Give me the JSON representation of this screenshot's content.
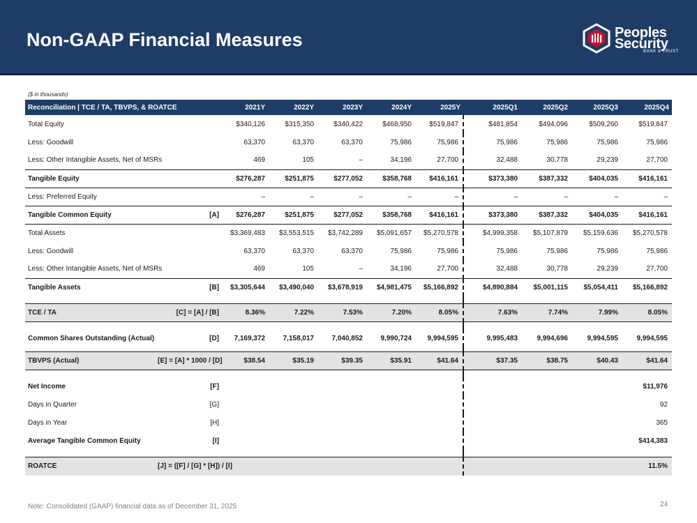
{
  "header": {
    "title": "Non-GAAP Financial Measures"
  },
  "logo": {
    "name_line1": "Peoples",
    "name_line2": "Security",
    "sub": "BANK & TRUST",
    "accent": "#c8102e"
  },
  "units_note": "($ in thousands)",
  "table": {
    "header_label": "Reconciliation | TCE / TA, TBVPS, & ROATCE",
    "columns": [
      "2021Y",
      "2022Y",
      "2023Y",
      "2024Y",
      "2025Y",
      "2025Q1",
      "2025Q2",
      "2025Q3",
      "2025Q4"
    ],
    "rows": [
      {
        "label": "Total Equity",
        "ref": "",
        "values": [
          "$340,126",
          "$315,350",
          "$340,422",
          "$468,950",
          "$519,847",
          "$481,854",
          "$494,096",
          "$509,260",
          "$519,847"
        ]
      },
      {
        "label": "Less: Goodwill",
        "ref": "",
        "values": [
          "63,370",
          "63,370",
          "63,370",
          "75,986",
          "75,986",
          "75,986",
          "75,986",
          "75,986",
          "75,986"
        ]
      },
      {
        "label": "Less: Other Intangible Assets, Net of MSRs",
        "ref": "",
        "values": [
          "469",
          "105",
          "–",
          "34,196",
          "27,700",
          "32,488",
          "30,778",
          "29,239",
          "27,700"
        ]
      },
      {
        "label": "Tangible Equity",
        "ref": "",
        "values": [
          "$276,287",
          "$251,875",
          "$277,052",
          "$358,768",
          "$416,161",
          "$373,380",
          "$387,332",
          "$404,035",
          "$416,161"
        ]
      },
      {
        "label": "Less: Preferred Equity",
        "ref": "",
        "values": [
          "–",
          "–",
          "–",
          "–",
          "–",
          "–",
          "–",
          "–",
          "–"
        ]
      },
      {
        "label": "Tangible Common Equity",
        "ref": "[A]",
        "values": [
          "$276,287",
          "$251,875",
          "$277,052",
          "$358,768",
          "$416,161",
          "$373,380",
          "$387,332",
          "$404,035",
          "$416,161"
        ]
      },
      {
        "label": "Total Assets",
        "ref": "",
        "values": [
          "$3,369,483",
          "$3,553,515",
          "$3,742,289",
          "$5,091,657",
          "$5,270,578",
          "$4,999,358",
          "$5,107,879",
          "$5,159,636",
          "$5,270,578"
        ]
      },
      {
        "label": "Less: Goodwill",
        "ref": "",
        "values": [
          "63,370",
          "63,370",
          "63,370",
          "75,986",
          "75,986",
          "75,986",
          "75,986",
          "75,986",
          "75,986"
        ]
      },
      {
        "label": "Less: Other Intangible Assets, Net of MSRs",
        "ref": "",
        "values": [
          "469",
          "105",
          "–",
          "34,196",
          "27,700",
          "32,488",
          "30,778",
          "29,239",
          "27,700"
        ]
      },
      {
        "label": "Tangible Assets",
        "ref": "[B]",
        "values": [
          "$3,305,644",
          "$3,490,040",
          "$3,678,919",
          "$4,981,475",
          "$5,166,892",
          "$4,890,884",
          "$5,001,115",
          "$5,054,411",
          "$5,166,892"
        ]
      },
      {
        "label": "TCE / TA",
        "ref": "[C] = [A] / [B]",
        "values": [
          "8.36%",
          "7.22%",
          "7.53%",
          "7.20%",
          "8.05%",
          "7.63%",
          "7.74%",
          "7.99%",
          "8.05%"
        ]
      },
      {
        "label": "Common Shares Outstanding (Actual)",
        "ref": "[D]",
        "values": [
          "7,169,372",
          "7,158,017",
          "7,040,852",
          "9,990,724",
          "9,994,595",
          "9,995,483",
          "9,994,696",
          "9,994,595",
          "9,994,595"
        ]
      },
      {
        "label": "TBVPS (Actual)",
        "ref": "[E] = [A] * 1000 / [D]",
        "values": [
          "$38.54",
          "$35.19",
          "$39.35",
          "$35.91",
          "$41.64",
          "$37.35",
          "$38.75",
          "$40.43",
          "$41.64"
        ]
      },
      {
        "label": "Net Income",
        "ref": "[F]",
        "values": [
          "",
          "",
          "",
          "",
          "",
          "",
          "",
          "",
          "$11,976"
        ]
      },
      {
        "label": "Days in Quarter",
        "ref": "[G]",
        "values": [
          "",
          "",
          "",
          "",
          "",
          "",
          "",
          "",
          "92"
        ]
      },
      {
        "label": "Days in Year",
        "ref": "[H]",
        "values": [
          "",
          "",
          "",
          "",
          "",
          "",
          "",
          "",
          "365"
        ]
      },
      {
        "label": "Average Tangible Common Equity",
        "ref": "[I]",
        "values": [
          "",
          "",
          "",
          "",
          "",
          "",
          "",
          "",
          "$414,383"
        ]
      },
      {
        "label": "ROATCE",
        "ref": "[J] = ([F] / [G] * [H]) / [I]",
        "values": [
          "",
          "",
          "",
          "",
          "",
          "",
          "",
          "",
          "11.5%"
        ]
      }
    ]
  },
  "footer": {
    "note": "Note: Consolidated (GAAP) financial data as of December 31, 2025",
    "page": "24"
  }
}
